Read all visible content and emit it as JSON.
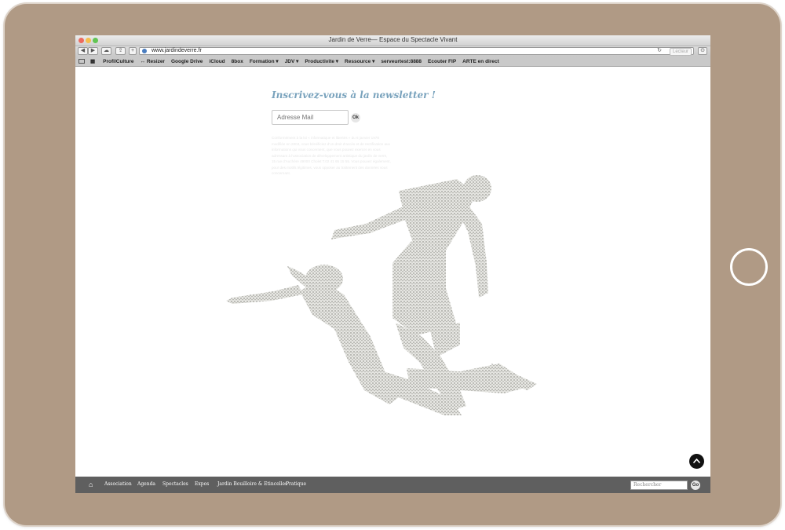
{
  "browser": {
    "window_title": "Jardin de Verre— Espace du Spectacle Vivant",
    "url": "www.jardindeverre.fr",
    "reader_label": "Lecteur",
    "bookmarks": [
      "ProfilCulture",
      "↔ Resizer",
      "Google Drive",
      "iCloud",
      "8box",
      "Formation ▾",
      "JDV ▾",
      "Productivite ▾",
      "Ressource ▾",
      "serveurtest:8888",
      "Ecouter FIP",
      "ARTE en direct"
    ]
  },
  "newsletter": {
    "title": "Inscrivez-vous à la newsletter !",
    "email_placeholder": "Adresse Mail",
    "ok_label": "Ok",
    "legal_text": "Conformément à la loi « informatique et libertés » du 6 janvier 1978 modifiée en 2004, vous bénéficiez d'un droit d'accès et de rectification aux informations qui vous concernent, que vous pouvez exercer en vous adressant à l'association de développement artistique du jardin de verre, 15 rue d'Auchère 49000 Cholet T.02 41 65 15 55. Vous pouvez également, pour des motifs légitimes, vous opposer au traitement des données vous concernant."
  },
  "nav": {
    "items": [
      "Association",
      "Agenda",
      "Spectacles",
      "Expos",
      "Jardin Bouilloire & Etincelles",
      "Pratique"
    ],
    "search_placeholder": "Rechercher",
    "go_label": "Go"
  },
  "colors": {
    "device_frame": "#b09a85",
    "title_accent": "#7aa3bd",
    "nav_background": "#5f5f5f"
  },
  "icons": [
    "home-icon",
    "scroll-top-icon",
    "globe-icon",
    "reload-icon",
    "bookmarks-icon"
  ]
}
